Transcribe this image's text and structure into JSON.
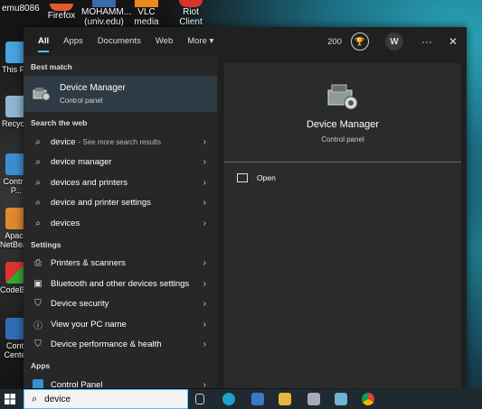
{
  "desktop": {
    "top_icons": [
      "emu8086",
      "Firefox",
      "MOHAMM... (univ.edu) ...",
      "VLC media player",
      "Riot Client"
    ],
    "left_icons": [
      "This P...",
      "Recycle",
      "Control P...",
      "Apach NetBea...",
      "CodeBlo...",
      "Contr Center"
    ]
  },
  "search": {
    "tabs": [
      "All",
      "Apps",
      "Documents",
      "Web",
      "More"
    ],
    "points": "200",
    "avatar_letter": "W",
    "more_icon": "chevron-down",
    "ellipsis": "···",
    "close": "✕",
    "best_match_label": "Best match",
    "best_match": {
      "title": "Device Manager",
      "subtitle": "Control panel"
    },
    "search_web_label": "Search the web",
    "web_results": [
      {
        "text": "device",
        "sub": " - See more search results"
      },
      {
        "text": "device manager",
        "sub": ""
      },
      {
        "text": "devices and printers",
        "sub": ""
      },
      {
        "text": "device and printer settings",
        "sub": ""
      },
      {
        "text": "devices",
        "sub": ""
      }
    ],
    "settings_label": "Settings",
    "settings": [
      {
        "text": "Printers & scanners",
        "icon": "printer-icon"
      },
      {
        "text": "Bluetooth and other devices settings",
        "icon": "bluetooth-icon"
      },
      {
        "text": "Device security",
        "icon": "shield-icon"
      },
      {
        "text": "View your PC name",
        "icon": "info-icon"
      },
      {
        "text": "Device performance & health",
        "icon": "shield-icon"
      }
    ],
    "apps_label": "Apps",
    "apps": [
      {
        "text": "Control Panel",
        "icon": "control-panel-icon"
      }
    ],
    "detail": {
      "title": "Device Manager",
      "subtitle": "Control panel",
      "action": "Open"
    }
  },
  "taskbar": {
    "search_value": "device"
  }
}
